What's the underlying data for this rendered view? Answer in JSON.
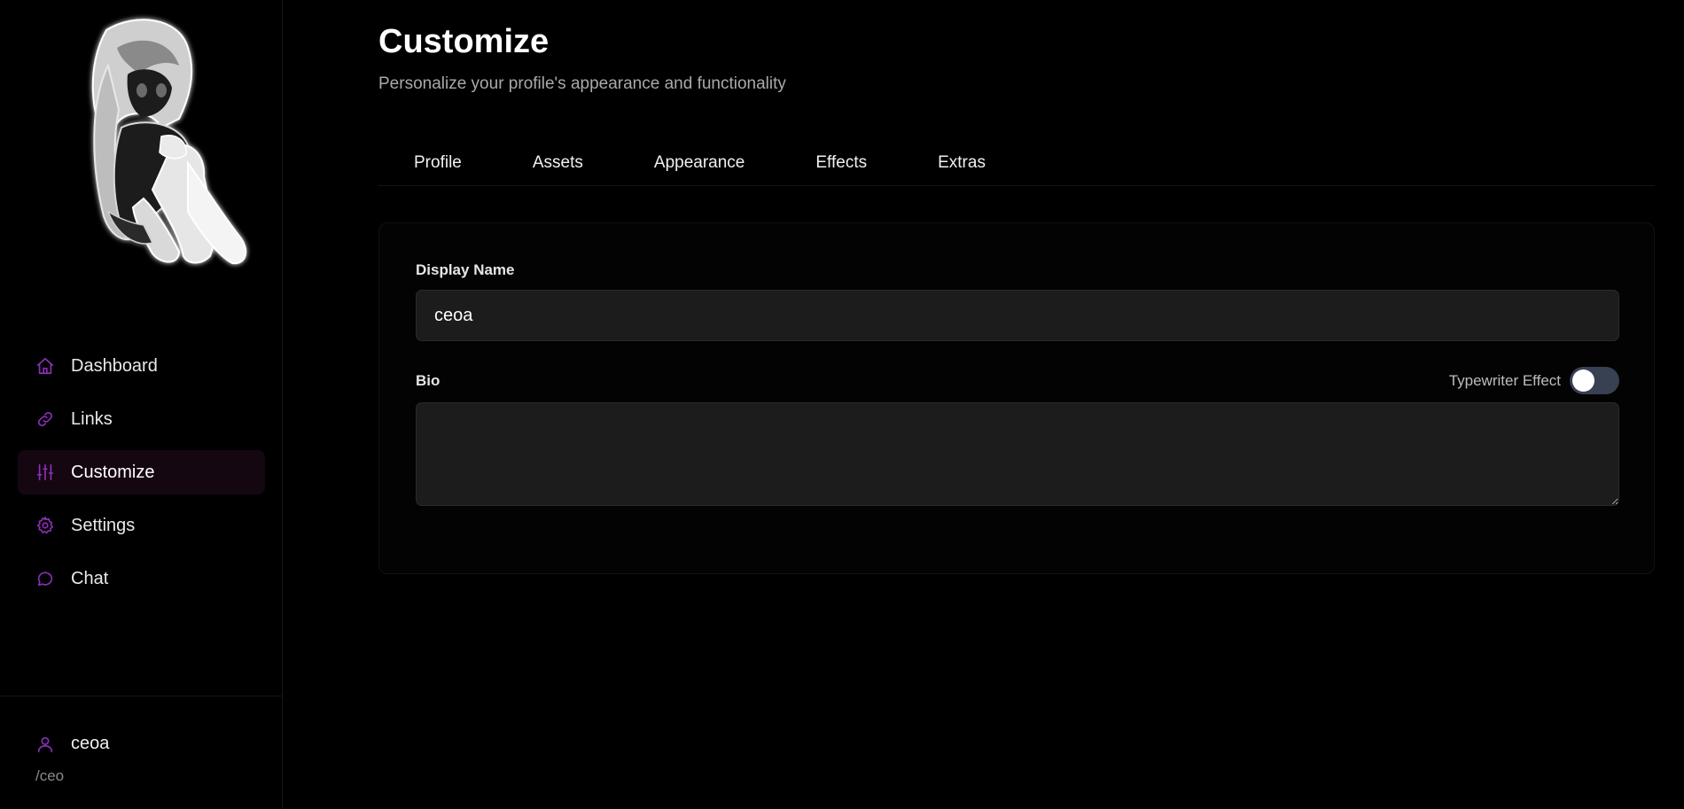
{
  "colors": {
    "accent": "#8b2fb8",
    "active_nav_bg": "#140712",
    "input_bg": "#1c1c1c",
    "toggle_off": "#374151"
  },
  "sidebar": {
    "avatar_art": "anime-girl-sitting-illustration",
    "items": [
      {
        "label": "Dashboard",
        "icon": "home-icon",
        "active": false
      },
      {
        "label": "Links",
        "icon": "link-icon",
        "active": false
      },
      {
        "label": "Customize",
        "icon": "sliders-icon",
        "active": true
      },
      {
        "label": "Settings",
        "icon": "gear-icon",
        "active": false
      },
      {
        "label": "Chat",
        "icon": "chat-icon",
        "active": false
      }
    ],
    "user": {
      "name": "ceoa",
      "handle": "/ceo",
      "icon": "user-icon"
    }
  },
  "header": {
    "title": "Customize",
    "subtitle": "Personalize your profile's appearance and functionality"
  },
  "tabs": [
    {
      "label": "Profile"
    },
    {
      "label": "Assets"
    },
    {
      "label": "Appearance"
    },
    {
      "label": "Effects"
    },
    {
      "label": "Extras"
    }
  ],
  "form": {
    "display_name_label": "Display Name",
    "display_name_value": "ceoa",
    "bio_label": "Bio",
    "bio_value": "",
    "typewriter_label": "Typewriter Effect",
    "typewriter_enabled": false
  }
}
